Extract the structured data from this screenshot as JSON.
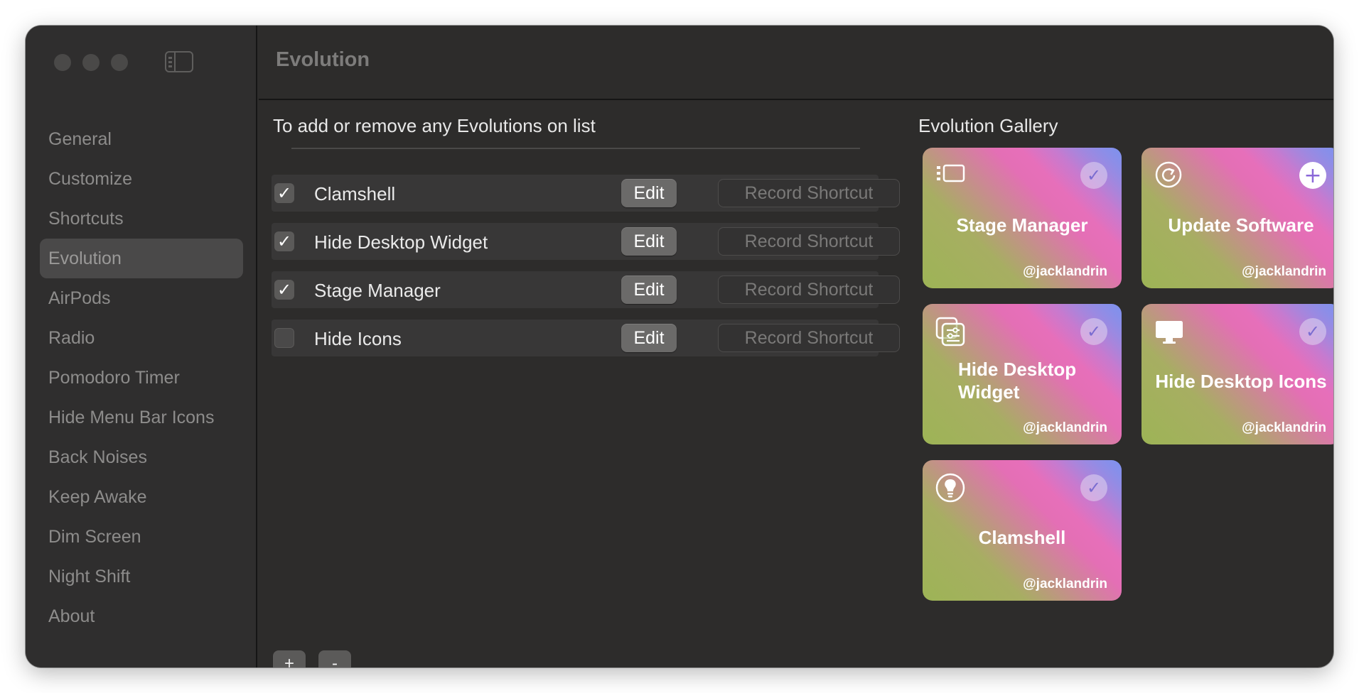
{
  "window": {
    "title": "Evolution"
  },
  "sidebar": {
    "items": [
      {
        "label": "General"
      },
      {
        "label": "Customize"
      },
      {
        "label": "Shortcuts"
      },
      {
        "label": "Evolution",
        "active": true
      },
      {
        "label": "AirPods"
      },
      {
        "label": "Radio"
      },
      {
        "label": "Pomodoro Timer"
      },
      {
        "label": "Hide Menu Bar Icons"
      },
      {
        "label": "Back Noises"
      },
      {
        "label": "Keep Awake"
      },
      {
        "label": "Dim Screen"
      },
      {
        "label": "Night Shift"
      },
      {
        "label": "About"
      }
    ]
  },
  "list": {
    "title": "To add or remove any Evolutions on list",
    "rows": [
      {
        "label": "Clamshell",
        "checked": true,
        "edit": "Edit",
        "record": "Record Shortcut"
      },
      {
        "label": "Hide Desktop Widget",
        "checked": true,
        "edit": "Edit",
        "record": "Record Shortcut"
      },
      {
        "label": "Stage Manager",
        "checked": true,
        "edit": "Edit",
        "record": "Record Shortcut"
      },
      {
        "label": "Hide Icons",
        "checked": false,
        "edit": "Edit",
        "record": "Record Shortcut"
      }
    ],
    "add_label": "+",
    "remove_label": "-"
  },
  "gallery": {
    "title": "Evolution Gallery",
    "cards": [
      {
        "title": "Stage Manager",
        "author": "@jacklandrin",
        "icon": "stage-manager-icon",
        "status": "added"
      },
      {
        "title": "Update Software",
        "author": "@jacklandrin",
        "icon": "update-icon",
        "status": "add"
      },
      {
        "title": "Hide Desktop Widget",
        "author": "@jacklandrin",
        "icon": "widget-icon",
        "status": "added"
      },
      {
        "title": "Hide Desktop Icons",
        "author": "@jacklandrin",
        "icon": "desktop-icon",
        "status": "added"
      },
      {
        "title": "Clamshell",
        "author": "@jacklandrin",
        "icon": "lightbulb-icon",
        "status": "added"
      }
    ]
  },
  "glyphs": {
    "check": "✓",
    "plus": "+"
  },
  "colors": {
    "window_bg": "#2d2c2b",
    "sidebar_active": "#4a4949",
    "card_green": "#9db456",
    "card_pink": "#e46fb5",
    "card_blue": "#7d91ee"
  }
}
